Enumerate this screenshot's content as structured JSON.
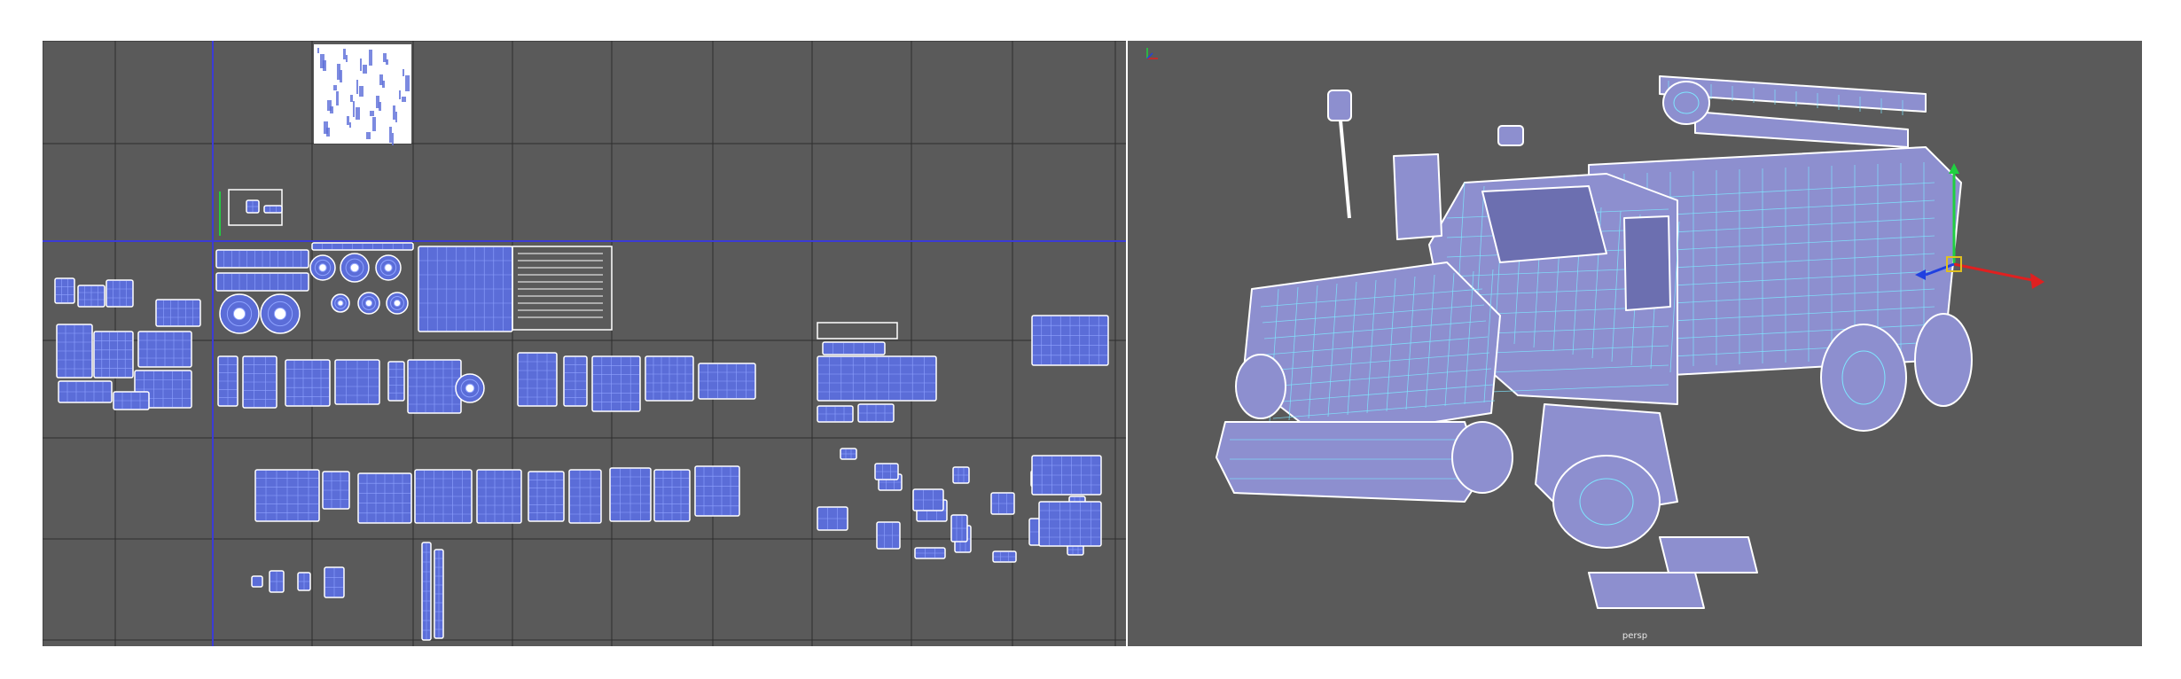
{
  "uv_editor": {
    "panel_name": "uv-editor-viewport",
    "colors": {
      "background": "#5a5a5a",
      "grid_line": "#2e2e2e",
      "axis_line": "#3b3bd6",
      "shell_fill": "#5b6dd8",
      "shell_edge": "#ffffff",
      "shell_wire": "#8fa3ff"
    }
  },
  "perspective_view": {
    "panel_name": "perspective-viewport",
    "camera_label": "persp",
    "colors": {
      "background": "#5d5d5d",
      "mesh_fill": "#8d8fcf",
      "mesh_wire": "#7fe6ff",
      "mesh_outline": "#ffffff",
      "gizmo_x": "#e02020",
      "gizmo_y": "#20d040",
      "gizmo_z": "#2040e0",
      "gizmo_center": "#e0c020"
    },
    "icons": [
      "transform-gizmo-icon",
      "view-axis-indicator-icon"
    ]
  }
}
